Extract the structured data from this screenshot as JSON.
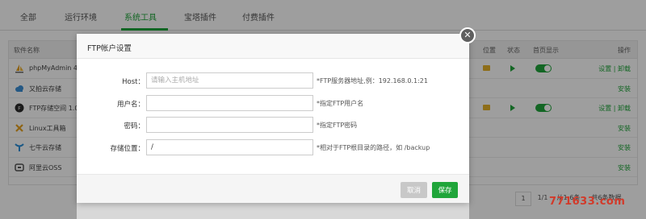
{
  "colors": {
    "accent": "#20a53a",
    "folder": "#e5b22b"
  },
  "tabs": [
    {
      "label": "全部"
    },
    {
      "label": "运行环境"
    },
    {
      "label": "系统工具",
      "active": true
    },
    {
      "label": "宝塔插件"
    },
    {
      "label": "付费插件"
    }
  ],
  "table": {
    "headers": {
      "name": "软件名称",
      "location": "位置",
      "status": "状态",
      "homepage": "首页显示",
      "action": "操作"
    },
    "rows": [
      {
        "name": "phpMyAdmin 4",
        "icon": "sailboat-icon",
        "action": "设置 | 卸载",
        "installed": true
      },
      {
        "name": "又拍云存储",
        "icon": "cloud-icon",
        "action": "安装",
        "installed": false
      },
      {
        "name": "FTP存储空间 1.0",
        "icon": "ftp-icon",
        "action": "设置 | 卸载",
        "installed": true
      },
      {
        "name": "Linux工具箱",
        "icon": "tools-icon",
        "action": "安装",
        "installed": false
      },
      {
        "name": "七牛云存储",
        "icon": "qiniu-icon",
        "action": "安装",
        "installed": false
      },
      {
        "name": "阿里云OSS",
        "icon": "oss-icon",
        "action": "安装",
        "installed": false
      }
    ]
  },
  "pager": {
    "page": "1",
    "pages": "1/1",
    "per_page": "从1-6条",
    "total": "共6条数据"
  },
  "modal": {
    "title": "FTP帐户设置",
    "fields": [
      {
        "label": "Host：",
        "value": "",
        "placeholder": "请输入主机地址",
        "hint": "*FTP服务器地址,例：192.168.0.1:21"
      },
      {
        "label": "用户名：",
        "value": "",
        "placeholder": "",
        "hint": "*指定FTP用户名"
      },
      {
        "label": "密码：",
        "value": "",
        "placeholder": "",
        "hint": "*指定FTP密码"
      },
      {
        "label": "存储位置：",
        "value": "/",
        "placeholder": "",
        "hint": "*相对于FTP根目录的路径，如 /backup"
      }
    ],
    "cancel_label": "取消",
    "save_label": "保存",
    "close_icon": "close-icon"
  },
  "watermark": "771633.com"
}
